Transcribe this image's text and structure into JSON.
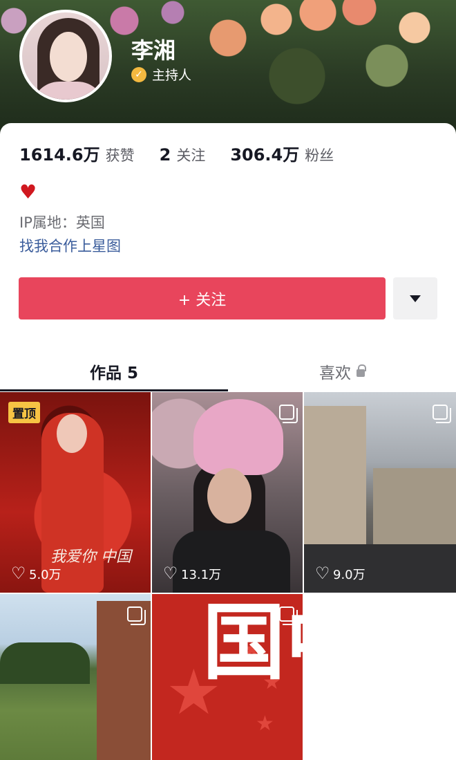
{
  "profile": {
    "name": "李湘",
    "verified_label": "主持人"
  },
  "stats": {
    "likes_value": "1614.6万",
    "likes_label": "获赞",
    "following_value": "2",
    "following_label": "关注",
    "followers_value": "306.4万",
    "followers_label": "粉丝"
  },
  "bio": {
    "emoji": "♥",
    "ip_location": "IP属地：英国",
    "star_link": "找我合作上星图"
  },
  "actions": {
    "follow_label": "+ 关注",
    "more_icon": "triangle-down-icon"
  },
  "tabs": {
    "works_label": "作品 5",
    "likes_label": "喜欢"
  },
  "videos": [
    {
      "likes": "5.0万",
      "pinned_label": "置顶",
      "caption": "我爱你 中国"
    },
    {
      "likes": "13.1万"
    },
    {
      "likes": "9.0万"
    },
    {},
    {
      "overlay_text": "中国"
    }
  ],
  "colors": {
    "follow_button": "#e8455c",
    "verified_badge": "#f4b940",
    "link": "#3a5c9b"
  }
}
